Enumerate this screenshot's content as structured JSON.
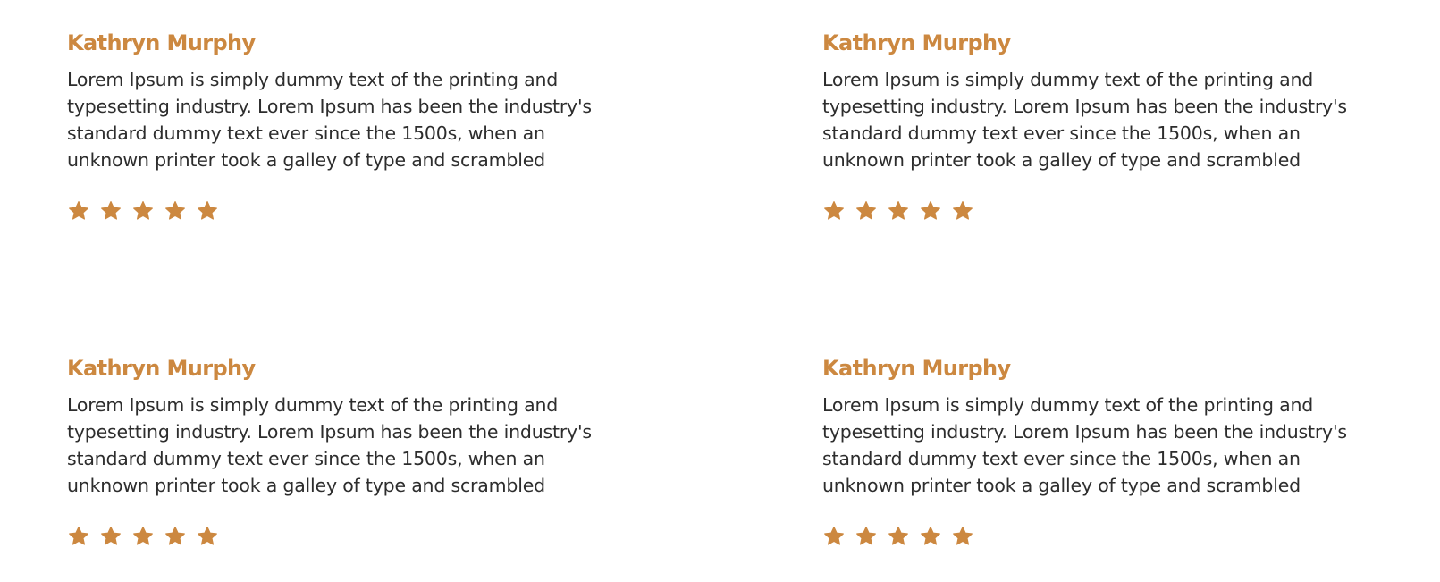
{
  "accent_color": "#CC8840",
  "testimonials": [
    {
      "name": "Kathryn Murphy",
      "text_lines": [
        "Lorem Ipsum is simply dummy text of the printing and",
        "typesetting industry. Lorem Ipsum has been the industry's",
        "standard dummy text ever since the 1500s, when an",
        "unknown printer took a galley of type and scrambled"
      ],
      "rating": 5,
      "rating_max": 5,
      "star_icon": "star-icon"
    },
    {
      "name": "Kathryn Murphy",
      "text_lines": [
        "Lorem Ipsum is simply dummy text of the printing and",
        "typesetting industry. Lorem Ipsum has been the industry's",
        "standard dummy text ever since the 1500s, when an",
        "unknown printer took a galley of type and scrambled"
      ],
      "rating": 5,
      "rating_max": 5,
      "star_icon": "star-icon"
    },
    {
      "name": "Kathryn Murphy",
      "text_lines": [
        "Lorem Ipsum is simply dummy text of the printing and",
        "typesetting industry. Lorem Ipsum has been the industry's",
        "standard dummy text ever since the 1500s, when an",
        "unknown printer took a galley of type and scrambled"
      ],
      "rating": 5,
      "rating_max": 5,
      "star_icon": "star-icon"
    },
    {
      "name": "Kathryn Murphy",
      "text_lines": [
        "Lorem Ipsum is simply dummy text of the printing and",
        "typesetting industry. Lorem Ipsum has been the industry's",
        "standard dummy text ever since the 1500s, when an",
        "unknown printer took a galley of type and scrambled"
      ],
      "rating": 5,
      "rating_max": 5,
      "star_icon": "star-icon"
    }
  ]
}
